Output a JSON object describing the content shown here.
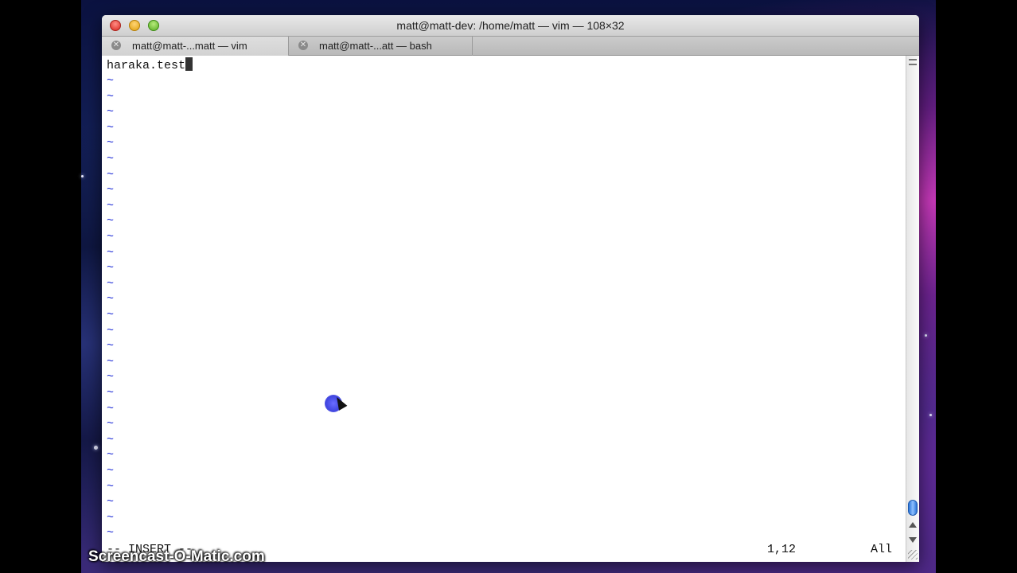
{
  "window": {
    "title": "matt@matt-dev: /home/matt — vim — 108×32"
  },
  "tabs": [
    {
      "label": "matt@matt-...matt — vim",
      "active": true
    },
    {
      "label": "matt@matt-...att — bash",
      "active": false
    }
  ],
  "editor": {
    "first_line": "haraka.test",
    "empty_line_marker": "~",
    "mode": "-- INSERT --",
    "cursor_position": "1,12",
    "scroll_status": "All"
  },
  "watermark": "Screencast-O-Matic.com",
  "colors": {
    "tilde": "#1d2bd6",
    "titlebar": "#d9d9d9",
    "close_button": "#e0443c",
    "minimize_button": "#f0b429",
    "maximize_button": "#6cbf2e",
    "scroll_thumb": "#3d86e8"
  }
}
